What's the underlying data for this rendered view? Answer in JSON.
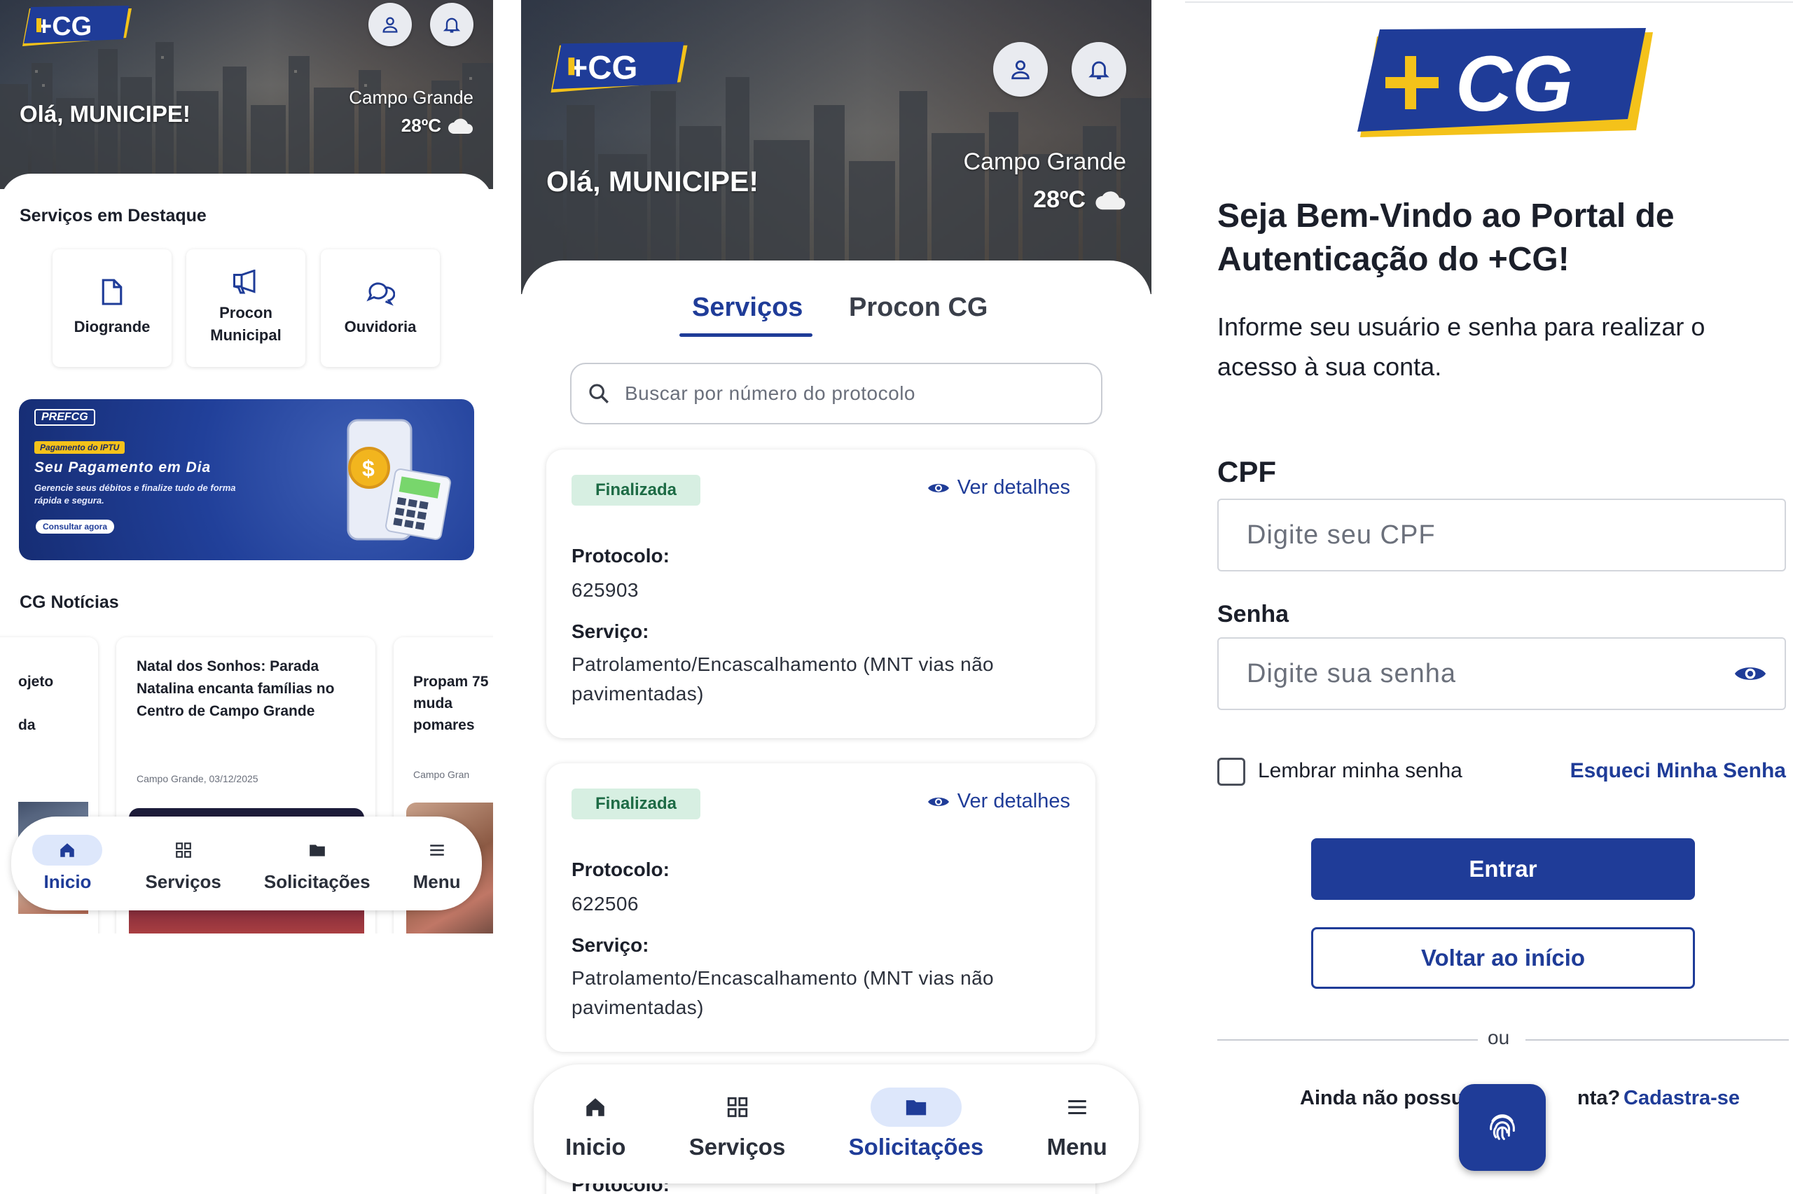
{
  "screen_home": {
    "greeting": "Olá, MUNICIPE!",
    "city": "Campo Grande",
    "temperature": "28ºC",
    "featured_title": "Serviços em Destaque",
    "featured_services": [
      {
        "label": "Diogrande",
        "icon": "document-icon"
      },
      {
        "label": "Procon Municipal",
        "icon": "megaphone-icon"
      },
      {
        "label": "Ouvidoria",
        "icon": "chat-bubbles-icon"
      }
    ],
    "banner": {
      "brand": "PREFCG",
      "tag": "Pagamento do IPTU",
      "headline": "Seu Pagamento em Dia",
      "body": "Gerencie seus débitos e finalize tudo de forma rápida e segura.",
      "cta": "Consultar agora"
    },
    "news_title": "CG Notícias",
    "news": [
      {
        "lines": [
          "ojeto",
          "",
          "da"
        ]
      },
      {
        "headline": "Natal dos Sonhos: Parada Natalina encanta famílias no Centro de Campo Grande",
        "meta": "Campo Grande, 03/12/2025"
      },
      {
        "headline": "Propam 75 muda pomares",
        "meta": "Campo Gran"
      }
    ],
    "nav": [
      "Inicio",
      "Serviços",
      "Solicitações",
      "Menu"
    ],
    "nav_active": "Inicio"
  },
  "screen_requests": {
    "greeting": "Olá, MUNICIPE!",
    "city": "Campo Grande",
    "temperature": "28ºC",
    "tabs": [
      "Serviços",
      "Procon CG"
    ],
    "active_tab": "Serviços",
    "search_placeholder": "Buscar por número do protocolo",
    "protocol_label": "Protocolo:",
    "service_label": "Serviço:",
    "details_label": "Ver detalhes",
    "requests": [
      {
        "status": "Finalizada",
        "protocol": "625903",
        "service": "Patrolamento/Encascalhamento (MNT vias não pavimentadas)"
      },
      {
        "status": "Finalizada",
        "protocol": "622506",
        "service": "Patrolamento/Encascalhamento (MNT vias não pavimentadas)"
      }
    ],
    "partial_label": "Protocolo:",
    "nav": [
      "Inicio",
      "Serviços",
      "Solicitações",
      "Menu"
    ],
    "nav_active": "Solicitações"
  },
  "screen_login": {
    "logo_text": "+CG",
    "title": "Seja Bem-Vindo ao Portal de Autenticação do +CG!",
    "subtitle": "Informe seu usuário e senha para realizar o acesso à sua conta.",
    "cpf_label": "CPF",
    "cpf_placeholder": "Digite seu CPF",
    "password_label": "Senha",
    "password_placeholder": "Digite sua senha",
    "remember_label": "Lembrar minha senha",
    "remember_checked": false,
    "forgot_label": "Esqueci Minha Senha",
    "login_button": "Entrar",
    "back_button": "Voltar ao início",
    "divider_text": "ou",
    "register_prompt_left": "Ainda não possui",
    "register_prompt_right": "nta?",
    "register_link": "Cadastra-se"
  },
  "colors": {
    "brand_blue": "#1f3c98",
    "brand_yellow": "#f4c21a",
    "status_green_bg": "#d7efe2",
    "status_green_text": "#1d6b45"
  }
}
